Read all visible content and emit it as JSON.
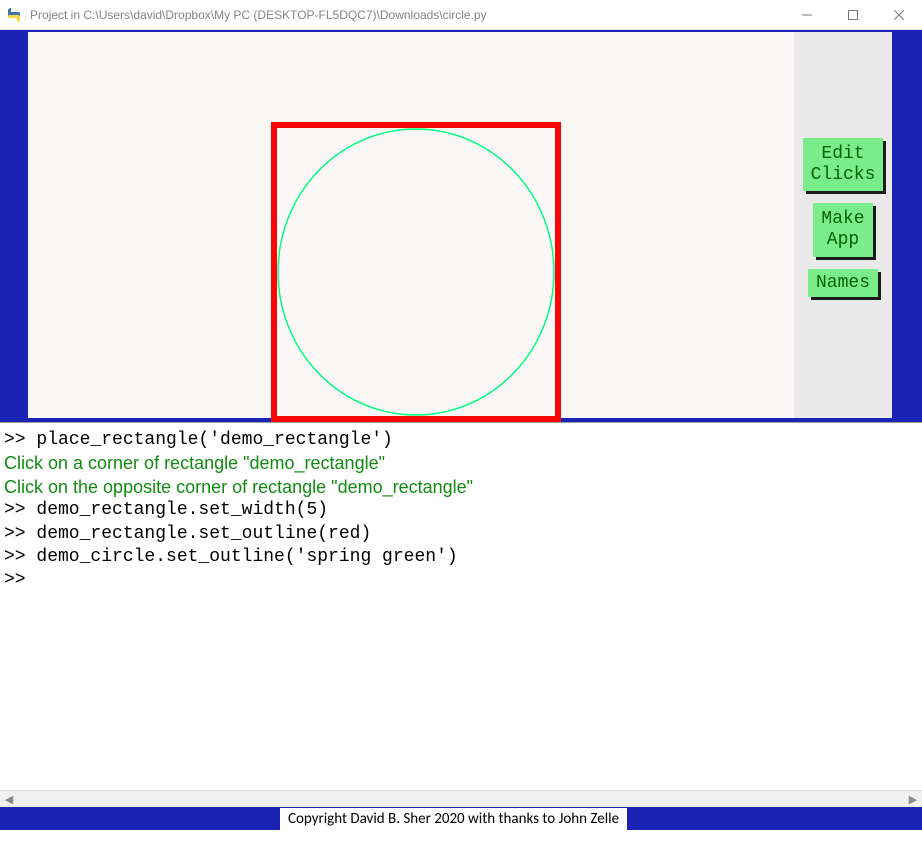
{
  "window": {
    "title": "Project in C:\\Users\\david\\Dropbox\\My PC (DESKTOP-FL5DQC7)\\Downloads\\circle.py"
  },
  "buttons": {
    "edit_clicks": "Edit\nClicks",
    "make_app": "Make\nApp",
    "names": "Names"
  },
  "shapes": {
    "rectangle": {
      "outline": "#f90606",
      "width": 5
    },
    "circle": {
      "outline": "#00ff7f"
    }
  },
  "console": {
    "lines": [
      {
        "kind": "cmd",
        "text": ">> place_rectangle('demo_rectangle')"
      },
      {
        "kind": "msg",
        "text": "Click on a corner of rectangle \"demo_rectangle\""
      },
      {
        "kind": "msg",
        "text": "Click on the opposite corner of rectangle \"demo_rectangle\""
      },
      {
        "kind": "cmd",
        "text": ">> demo_rectangle.set_width(5)"
      },
      {
        "kind": "cmd",
        "text": ">> demo_rectangle.set_outline(red)"
      },
      {
        "kind": "cmd",
        "text": ">> demo_circle.set_outline('spring green')"
      },
      {
        "kind": "cmd",
        "text": ">>"
      }
    ]
  },
  "footer": {
    "credit": "Copyright David B. Sher 2020 with thanks to John Zelle"
  }
}
